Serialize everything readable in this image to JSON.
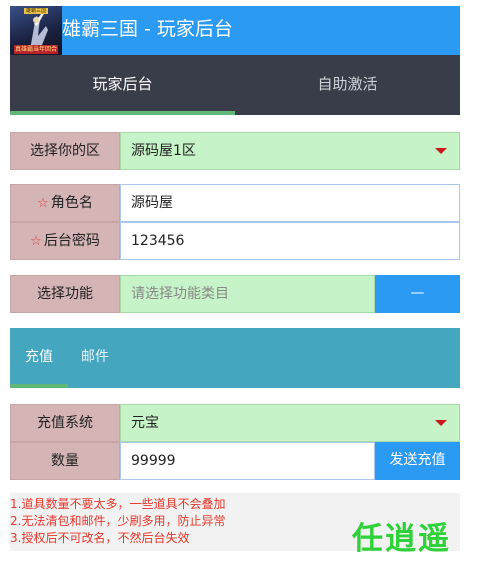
{
  "header": {
    "title": "雄霸三国 - 玩家后台",
    "logo_top": "雄霸三国",
    "logo_badge": "真雄霸当年回合"
  },
  "tabs": [
    {
      "label": "玩家后台",
      "active": true
    },
    {
      "label": "自助激活",
      "active": false
    }
  ],
  "form": {
    "server": {
      "label": "选择你的区",
      "value": "源码屋1区"
    },
    "role": {
      "star": "☆",
      "label": "角色名",
      "value": "源码屋"
    },
    "password": {
      "star": "☆",
      "label": "后台密码",
      "value": "123456"
    },
    "function": {
      "label": "选择功能",
      "placeholder": "请选择功能类目",
      "button": "—"
    }
  },
  "subtabs": [
    {
      "label": "充值",
      "active": true
    },
    {
      "label": "邮件",
      "active": false
    }
  ],
  "recharge": {
    "system": {
      "label": "充值系统",
      "value": "元宝"
    },
    "quantity": {
      "label": "数量",
      "value": "99999",
      "button": "发送充值"
    }
  },
  "notes": [
    "1.道具数量不要太多，一些道具不会叠加",
    "2.无法清包和邮件，少刷多用，防止异常",
    "3.授权后不可改名，不然后台失效"
  ],
  "brand": "任逍遥",
  "colors": {
    "header": "#2b9af3",
    "tabbar": "#393d49",
    "accent_green": "#5fb878",
    "subtabs": "#44a6bf",
    "label_bg": "#d4b4b5",
    "field_green": "#c6f3c8",
    "note_red": "#e5382c",
    "brand_green": "#2fd138"
  }
}
